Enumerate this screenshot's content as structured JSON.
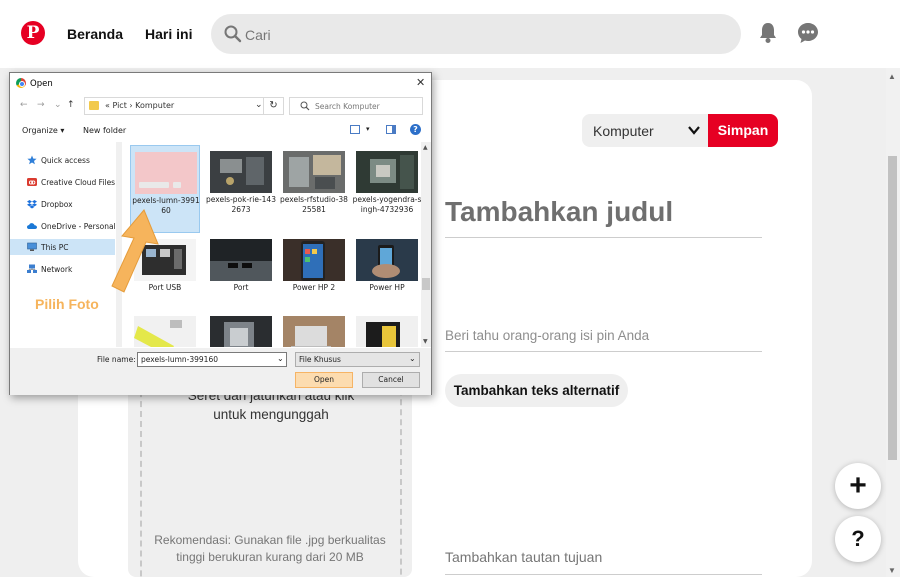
{
  "header": {
    "logo": "P",
    "nav": [
      "Beranda",
      "Hari ini"
    ],
    "search_placeholder": "Cari"
  },
  "pin_form": {
    "board_select": "Komputer",
    "save_button": "Simpan",
    "title_placeholder": "Tambahkan judul",
    "description_placeholder": "Beri tahu orang-orang isi pin Anda",
    "alt_text_button": "Tambahkan teks alternatif",
    "link_placeholder": "Tambahkan tautan tujuan",
    "upload_text_1": "Seret dan jatuhkan atau klik",
    "upload_text_2": "untuk mengunggah",
    "upload_recommendation": "Rekomendasi: Gunakan file .jpg berkualitas tinggi berukuran kurang dari 20 MB"
  },
  "fabs": {
    "plus": "+",
    "help": "?"
  },
  "dialog": {
    "title": "Open",
    "address_path": "«  Pict  ›  Komputer",
    "search_placeholder": "Search Komputer",
    "organize": "Organize ▾",
    "new_folder": "New folder",
    "nav_items": [
      {
        "label": "Quick access",
        "icon": "star-icon",
        "color": "#2f7fd8"
      },
      {
        "label": "Creative Cloud Files",
        "icon": "cloud-icon",
        "color": "#da3b2f"
      },
      {
        "label": "Dropbox",
        "icon": "dropbox-icon",
        "color": "#1a6fdb"
      },
      {
        "label": "OneDrive - Personal",
        "icon": "onedrive-icon",
        "color": "#1a78d6"
      },
      {
        "label": "This PC",
        "icon": "computer-icon",
        "color": "#4a90d9"
      },
      {
        "label": "Network",
        "icon": "network-icon",
        "color": "#3b7ecf"
      }
    ],
    "files": [
      {
        "name": "pexels-lumn-399160",
        "selected": true
      },
      {
        "name": "pexels-pok-rie-1432673",
        "selected": false
      },
      {
        "name": "pexels-rfstudio-3825581",
        "selected": false
      },
      {
        "name": "pexels-yogendra-singh-4732936",
        "selected": false
      },
      {
        "name": "Port USB",
        "selected": false
      },
      {
        "name": "Port",
        "selected": false
      },
      {
        "name": "Power HP 2",
        "selected": false
      },
      {
        "name": "Power HP",
        "selected": false
      },
      {
        "name": "",
        "selected": false
      },
      {
        "name": "",
        "selected": false
      },
      {
        "name": "",
        "selected": false
      },
      {
        "name": "",
        "selected": false
      }
    ],
    "file_name_label": "File name:",
    "file_name_value": "pexels-lumn-399160",
    "file_type": "File Khusus",
    "open_button": "Open",
    "cancel_button": "Cancel"
  },
  "annotation": "Pilih Foto",
  "colors": {
    "pinterest_red": "#e60023",
    "annotation_orange": "#f6b45c",
    "selection_blue": "#cce4f7"
  }
}
